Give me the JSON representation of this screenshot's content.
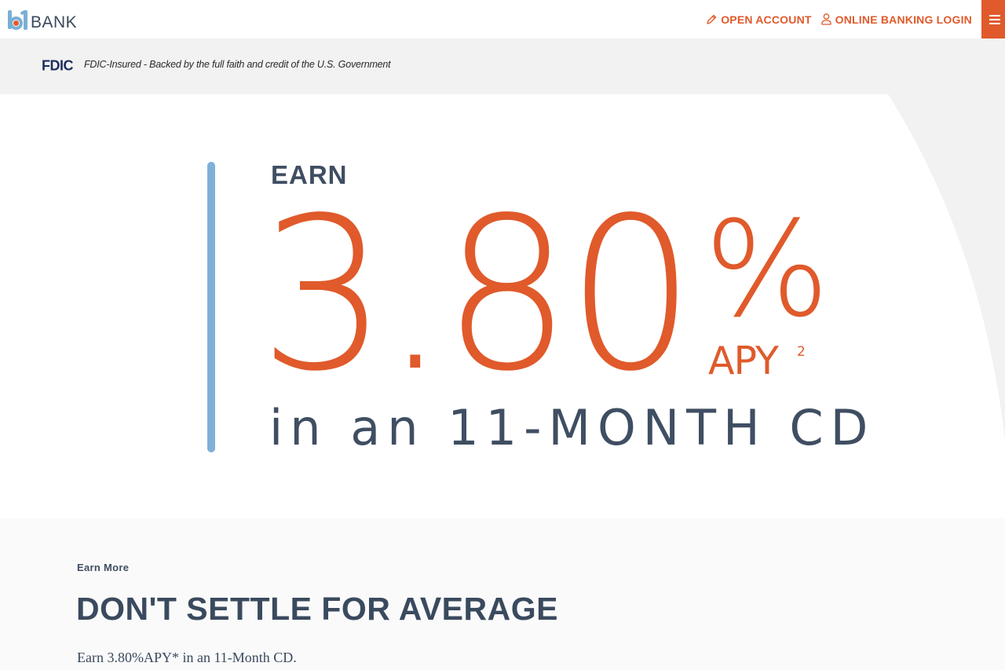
{
  "header": {
    "logo_text": "BANK",
    "logo_prefix": "b1",
    "nav": {
      "open_account": "OPEN ACCOUNT",
      "online_banking_login": "ONLINE BANKING LOGIN"
    },
    "icons": {
      "open_account": "pencil-icon",
      "login": "user-icon",
      "menu": "hamburger-menu-icon"
    }
  },
  "fdic_bar": {
    "logo": "FDIC",
    "text": "FDIC-Insured - Backed by the full faith and credit of the U.S. Government"
  },
  "hero": {
    "earn": "EARN",
    "rate": "3.80",
    "percent": "%",
    "apy": "APY",
    "apy_footnote": "2",
    "term": "in an 11-MONTH CD"
  },
  "content": {
    "eyebrow": "Earn More",
    "title": "DON'T SETTLE FOR AVERAGE",
    "body": "Earn 3.80%APY* in an 11-Month CD."
  },
  "colors": {
    "accent": "#e05a2b",
    "navy": "#3f4e62",
    "blue_bar": "#7fb0d9",
    "fdic_bar_bg": "#f2f2f2"
  }
}
